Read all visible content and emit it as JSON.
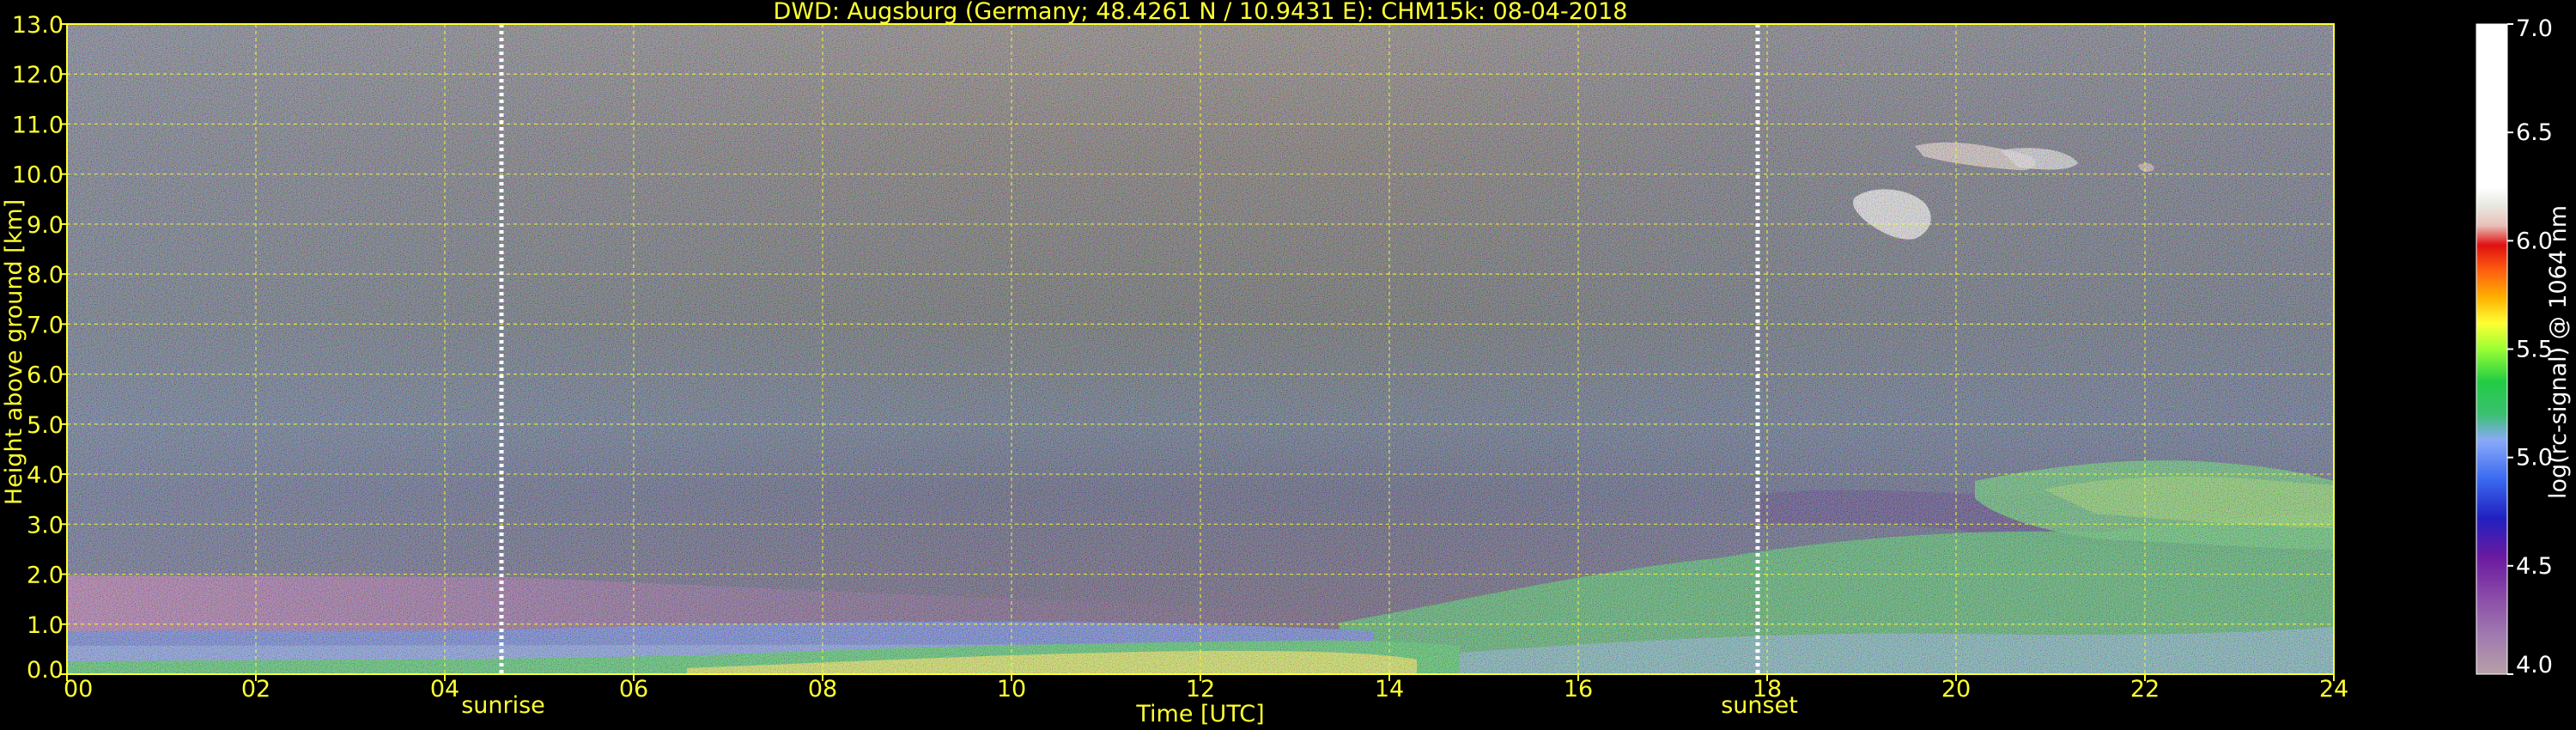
{
  "chart_data": {
    "type": "heatmap",
    "title": "DWD: Augsburg (Germany; 48.4261 N / 10.9431 E):    CHM15k: 08-04-2018",
    "xlabel": "Time [UTC]",
    "ylabel": "Height above ground [km]",
    "xlim": [
      0,
      24
    ],
    "ylim": [
      0,
      13
    ],
    "x_ticks": [
      "00",
      "02",
      "04",
      "06",
      "08",
      "10",
      "12",
      "14",
      "16",
      "18",
      "20",
      "22",
      "24"
    ],
    "y_ticks": [
      "0.0",
      "1.0",
      "2.0",
      "3.0",
      "4.0",
      "5.0",
      "6.0",
      "7.0",
      "8.0",
      "9.0",
      "10.0",
      "11.0",
      "12.0",
      "13.0"
    ],
    "grid": true,
    "markers": [
      {
        "label": "sunrise",
        "x": 4.6
      },
      {
        "label": "sunset",
        "x": 17.9
      }
    ],
    "colorbar": {
      "label": "log(rc-signal) @ 1064 nm",
      "range": [
        4.0,
        7.0
      ],
      "ticks": [
        "4.0",
        "4.5",
        "5.0",
        "5.5",
        "6.0",
        "6.5",
        "7.0"
      ]
    },
    "colors": {
      "background": "#000000",
      "text": "#ffff33",
      "grid": "#ffff33",
      "marker": "#ffffff"
    }
  }
}
